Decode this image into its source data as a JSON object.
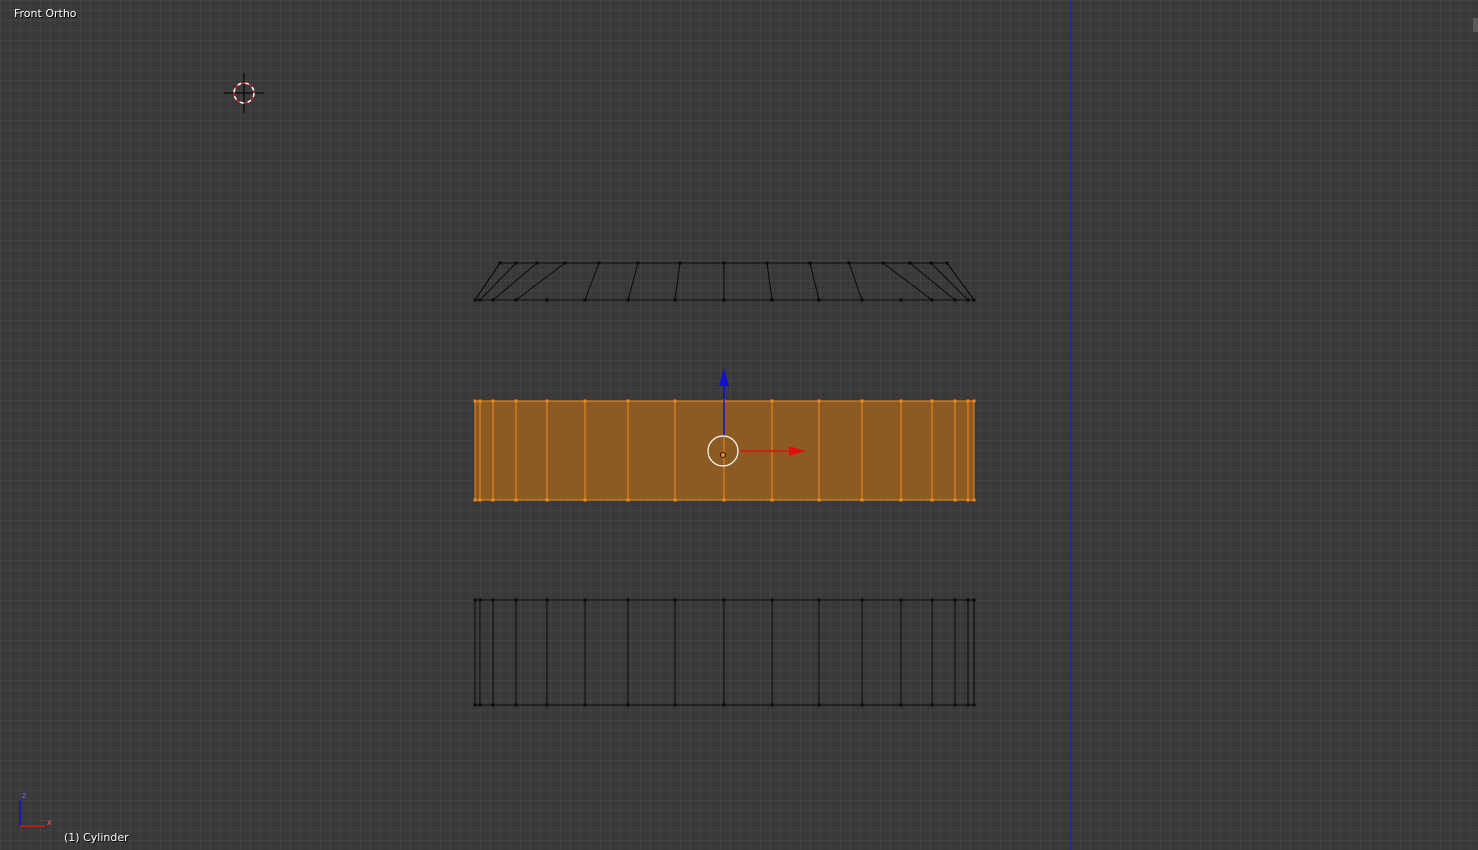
{
  "viewport": {
    "view_name": "Front Ortho",
    "object_info": "(1) Cylinder"
  },
  "axis_gizmo": {
    "x_label": "x",
    "z_label": "z"
  },
  "colors": {
    "background": "#393939",
    "mesh_wire": "#0a0a0a",
    "selection": "#f08a1a",
    "selection_fill": "#8c5a23",
    "axis_x": "#e01010",
    "axis_z": "#1010d0",
    "divider_line": "#1a2a8a"
  }
}
